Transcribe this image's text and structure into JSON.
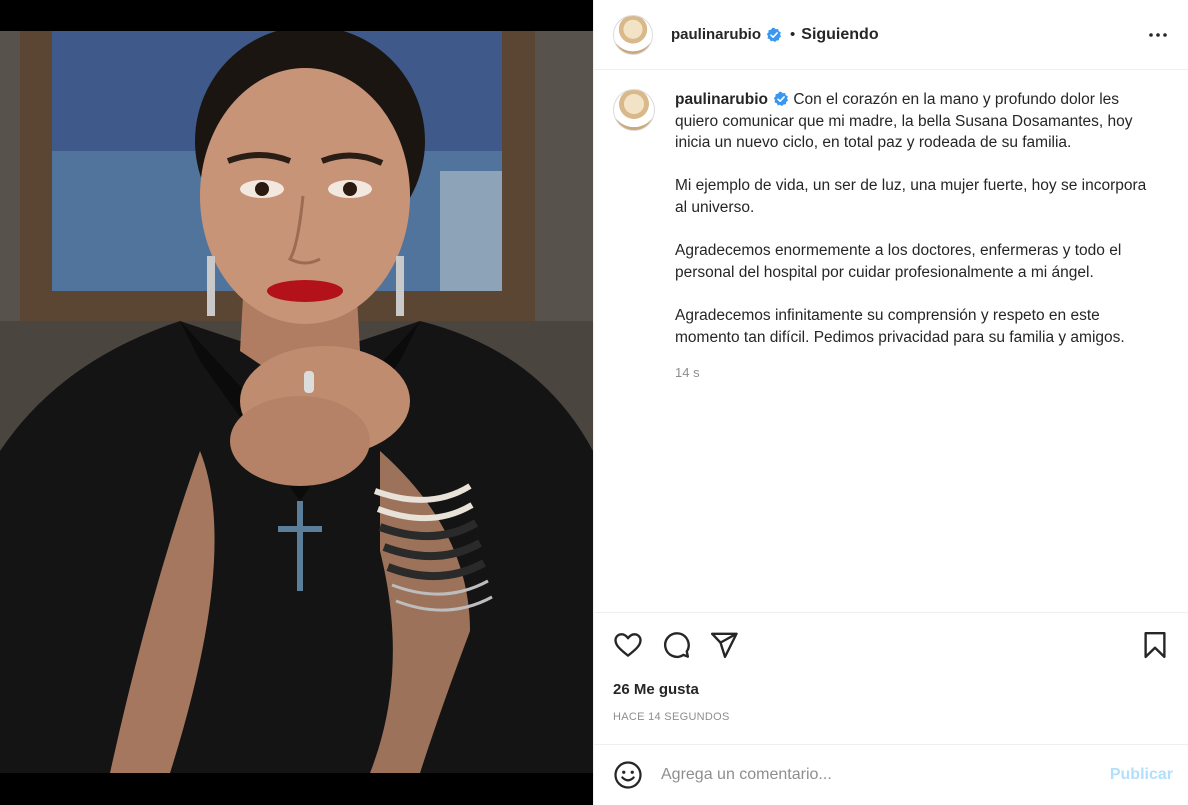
{
  "post": {
    "author": "paulinarubio",
    "follow_state": "Siguiendo",
    "separator": "•",
    "photo_alt": "Retrato de mujer con camisa negra y pulseras"
  },
  "caption": {
    "author": "paulinarubio",
    "paragraphs": [
      "Con el corazón en la mano y profundo dolor les quiero comunicar que mi madre, la bella Susana Dosamantes, hoy inicia un nuevo ciclo, en total paz y rodeada de su familia.",
      "Mi ejemplo de vida, un ser de luz, una mujer fuerte, hoy se incorpora al universo.",
      "Agradecemos enormemente a los doctores, enfermeras y todo el personal del hospital por cuidar profesionalmente a mi ángel.",
      "Agradecemos infinitamente su comprensión y respeto en este momento tan difícil. Pedimos privacidad para su familia y amigos."
    ],
    "relative_time": "14 s"
  },
  "actions": {
    "likes": "26 Me gusta",
    "timestamp": "HACE 14 SEGUNDOS"
  },
  "comment": {
    "placeholder": "Agrega un comentario...",
    "post_label": "Publicar"
  },
  "colors": {
    "text": "#262626",
    "muted": "#8e8e8e",
    "verified": "#3897f0",
    "publish_disabled": "#b2dffc",
    "border": "#efefef"
  },
  "icons": [
    "verified-badge-icon",
    "more-options-icon",
    "heart-icon",
    "comment-icon",
    "share-icon",
    "bookmark-icon",
    "emoji-icon"
  ]
}
